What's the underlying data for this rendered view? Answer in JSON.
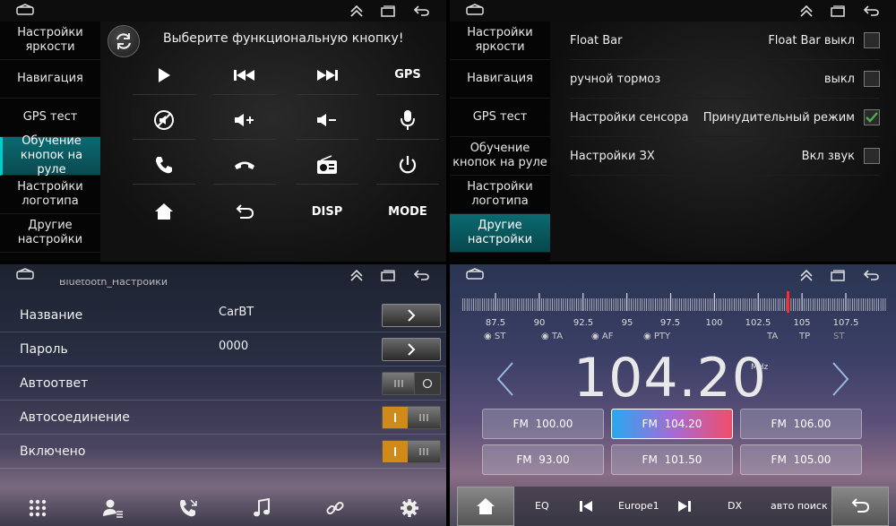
{
  "colors": {
    "accent_teal": "#0a6a70",
    "check_green": "#4caf50",
    "toggle_orange": "#d08a1a",
    "preset_active_start": "#2aa8f0",
    "preset_active_end": "#f04e6a",
    "tuner_marker": "#ff2a2a"
  },
  "sidebar": {
    "items": [
      {
        "label": "Настройки яркости"
      },
      {
        "label": "Навигация"
      },
      {
        "label": "GPS тест"
      },
      {
        "label": "Обучение кнопок на руле"
      },
      {
        "label": "Настройки логотипа"
      },
      {
        "label": "Другие настройки"
      }
    ]
  },
  "steering": {
    "title": "Выберите функциональную кнопку!",
    "buttons": [
      {
        "icon": "play-icon",
        "text": ""
      },
      {
        "icon": "prev-track-icon",
        "text": ""
      },
      {
        "icon": "next-track-icon",
        "text": ""
      },
      {
        "icon": "gps-text",
        "text": "GPS"
      },
      {
        "icon": "mute-icon",
        "text": ""
      },
      {
        "icon": "volume-up-icon",
        "text": ""
      },
      {
        "icon": "volume-down-icon",
        "text": ""
      },
      {
        "icon": "microphone-icon",
        "text": ""
      },
      {
        "icon": "phone-answer-icon",
        "text": ""
      },
      {
        "icon": "phone-hangup-icon",
        "text": ""
      },
      {
        "icon": "radio-icon",
        "text": ""
      },
      {
        "icon": "power-icon",
        "text": ""
      },
      {
        "icon": "home-icon",
        "text": ""
      },
      {
        "icon": "back-icon",
        "text": ""
      },
      {
        "icon": "disp-text",
        "text": "DISP"
      },
      {
        "icon": "mode-text",
        "text": "MODE"
      }
    ]
  },
  "other_settings": {
    "rows": [
      {
        "label": "Float Bar",
        "value": "Float Bar выкл",
        "checked": false
      },
      {
        "label": "ручной тормоз",
        "value": "выкл",
        "checked": false
      },
      {
        "label": "Настройки сенсора",
        "value": "Принудительный режим",
        "checked": true
      },
      {
        "label": "Настройки ЗХ",
        "value": "Вкл звук",
        "checked": false
      }
    ]
  },
  "bluetooth": {
    "header": "Bluetooth_Настройки",
    "rows": [
      {
        "label": "Название",
        "value": "CarBT",
        "control": "arrow"
      },
      {
        "label": "Пароль",
        "value": "0000",
        "control": "arrow"
      },
      {
        "label": "Автоответ",
        "value": "",
        "control": "toggle-off"
      },
      {
        "label": "Автосоединение",
        "value": "",
        "control": "toggle-on"
      },
      {
        "label": "Включено",
        "value": "",
        "control": "toggle-on"
      }
    ],
    "bottom_icons": [
      "dialpad-icon",
      "contacts-icon",
      "call-log-icon",
      "music-icon",
      "link-icon",
      "gear-icon"
    ]
  },
  "radio": {
    "scale_labels": [
      "87.5",
      "90",
      "92.5",
      "95",
      "97.5",
      "100",
      "102.5",
      "105",
      "107.5"
    ],
    "scale_flags": [
      "TA",
      "TP",
      "ST"
    ],
    "rds_flags": [
      "ST",
      "TA",
      "AF",
      "PTY"
    ],
    "frequency": "104.20",
    "unit": "MHz",
    "presets": [
      {
        "label": "FM",
        "freq": "100.00",
        "active": false
      },
      {
        "label": "FM",
        "freq": "104.20",
        "active": true
      },
      {
        "label": "FM",
        "freq": "106.00",
        "active": false
      },
      {
        "label": "FM",
        "freq": "93.00",
        "active": false
      },
      {
        "label": "FM",
        "freq": "101.50",
        "active": false
      },
      {
        "label": "FM",
        "freq": "105.00",
        "active": false
      }
    ],
    "bar": {
      "eq": "EQ",
      "region": "Europe1",
      "dx": "DX",
      "search": "авто поиск"
    }
  }
}
